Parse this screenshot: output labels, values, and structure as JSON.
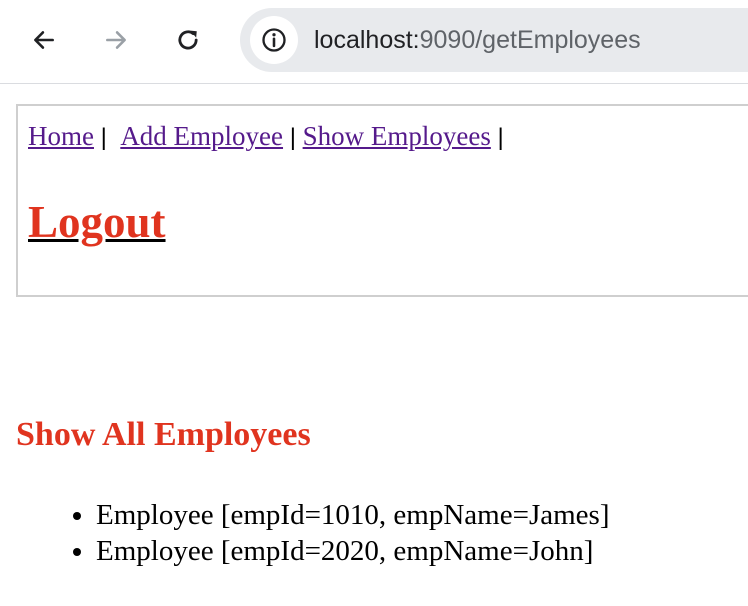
{
  "browser": {
    "url_host": "localhost:",
    "url_path": "9090/getEmployees",
    "back_icon": "arrow-left-icon",
    "forward_icon": "arrow-right-icon",
    "reload_icon": "reload-icon",
    "info_icon": "info-icon"
  },
  "menu": {
    "home": "Home",
    "sep1": " | ",
    "add_employee": "Add Employee",
    "sep2": " | ",
    "show_employees": "Show Employees",
    "sep3": " |",
    "logout": "Logout"
  },
  "main": {
    "heading": "Show All Employees",
    "employees": [
      "Employee [empId=1010, empName=James]",
      "Employee [empId=2020, empName=John]"
    ]
  },
  "colors": {
    "accent_red": "#e0341f",
    "link_visited": "#551a8b"
  }
}
